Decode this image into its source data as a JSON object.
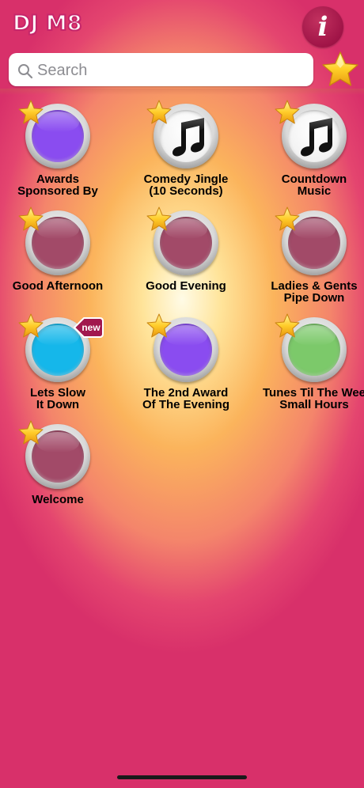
{
  "app": {
    "logo_text": "DJ M8",
    "info_label": "i"
  },
  "search": {
    "placeholder": "Search",
    "value": ""
  },
  "colors": {
    "purple": "#8a4cf0",
    "white": "#ffffff",
    "mauve": "#a24a68",
    "cyan": "#15b7ea",
    "green": "#7cc96a",
    "badge": "#a1184e"
  },
  "items": [
    {
      "label_line1": "Awards",
      "label_line2": "Sponsored By",
      "face": "purple",
      "icon": "none",
      "favorite": true,
      "is_new": false
    },
    {
      "label_line1": "Comedy Jingle",
      "label_line2": "(10 Seconds)",
      "face": "white",
      "icon": "music-note-icon",
      "favorite": true,
      "is_new": false
    },
    {
      "label_line1": "Countdown",
      "label_line2": "Music",
      "face": "white",
      "icon": "music-note-icon",
      "favorite": true,
      "is_new": false
    },
    {
      "label_line1": "Good Afternoon",
      "label_line2": "",
      "face": "mauve",
      "icon": "none",
      "favorite": true,
      "is_new": false
    },
    {
      "label_line1": "Good Evening",
      "label_line2": "",
      "face": "mauve",
      "icon": "none",
      "favorite": true,
      "is_new": false
    },
    {
      "label_line1": "Ladies & Gents",
      "label_line2": "Pipe Down",
      "face": "mauve",
      "icon": "none",
      "favorite": true,
      "is_new": false
    },
    {
      "label_line1": "Lets Slow",
      "label_line2": "It Down",
      "face": "cyan",
      "icon": "none",
      "favorite": true,
      "is_new": true
    },
    {
      "label_line1": "The 2nd Award",
      "label_line2": "Of The Evening",
      "face": "purple",
      "icon": "none",
      "favorite": true,
      "is_new": false
    },
    {
      "label_line1": "Tunes Til The Wee",
      "label_line2": "Small Hours",
      "face": "green",
      "icon": "none",
      "favorite": true,
      "is_new": false
    },
    {
      "label_line1": "Welcome",
      "label_line2": "",
      "face": "mauve",
      "icon": "none",
      "favorite": true,
      "is_new": false
    }
  ],
  "badge": {
    "new_label": "new"
  }
}
